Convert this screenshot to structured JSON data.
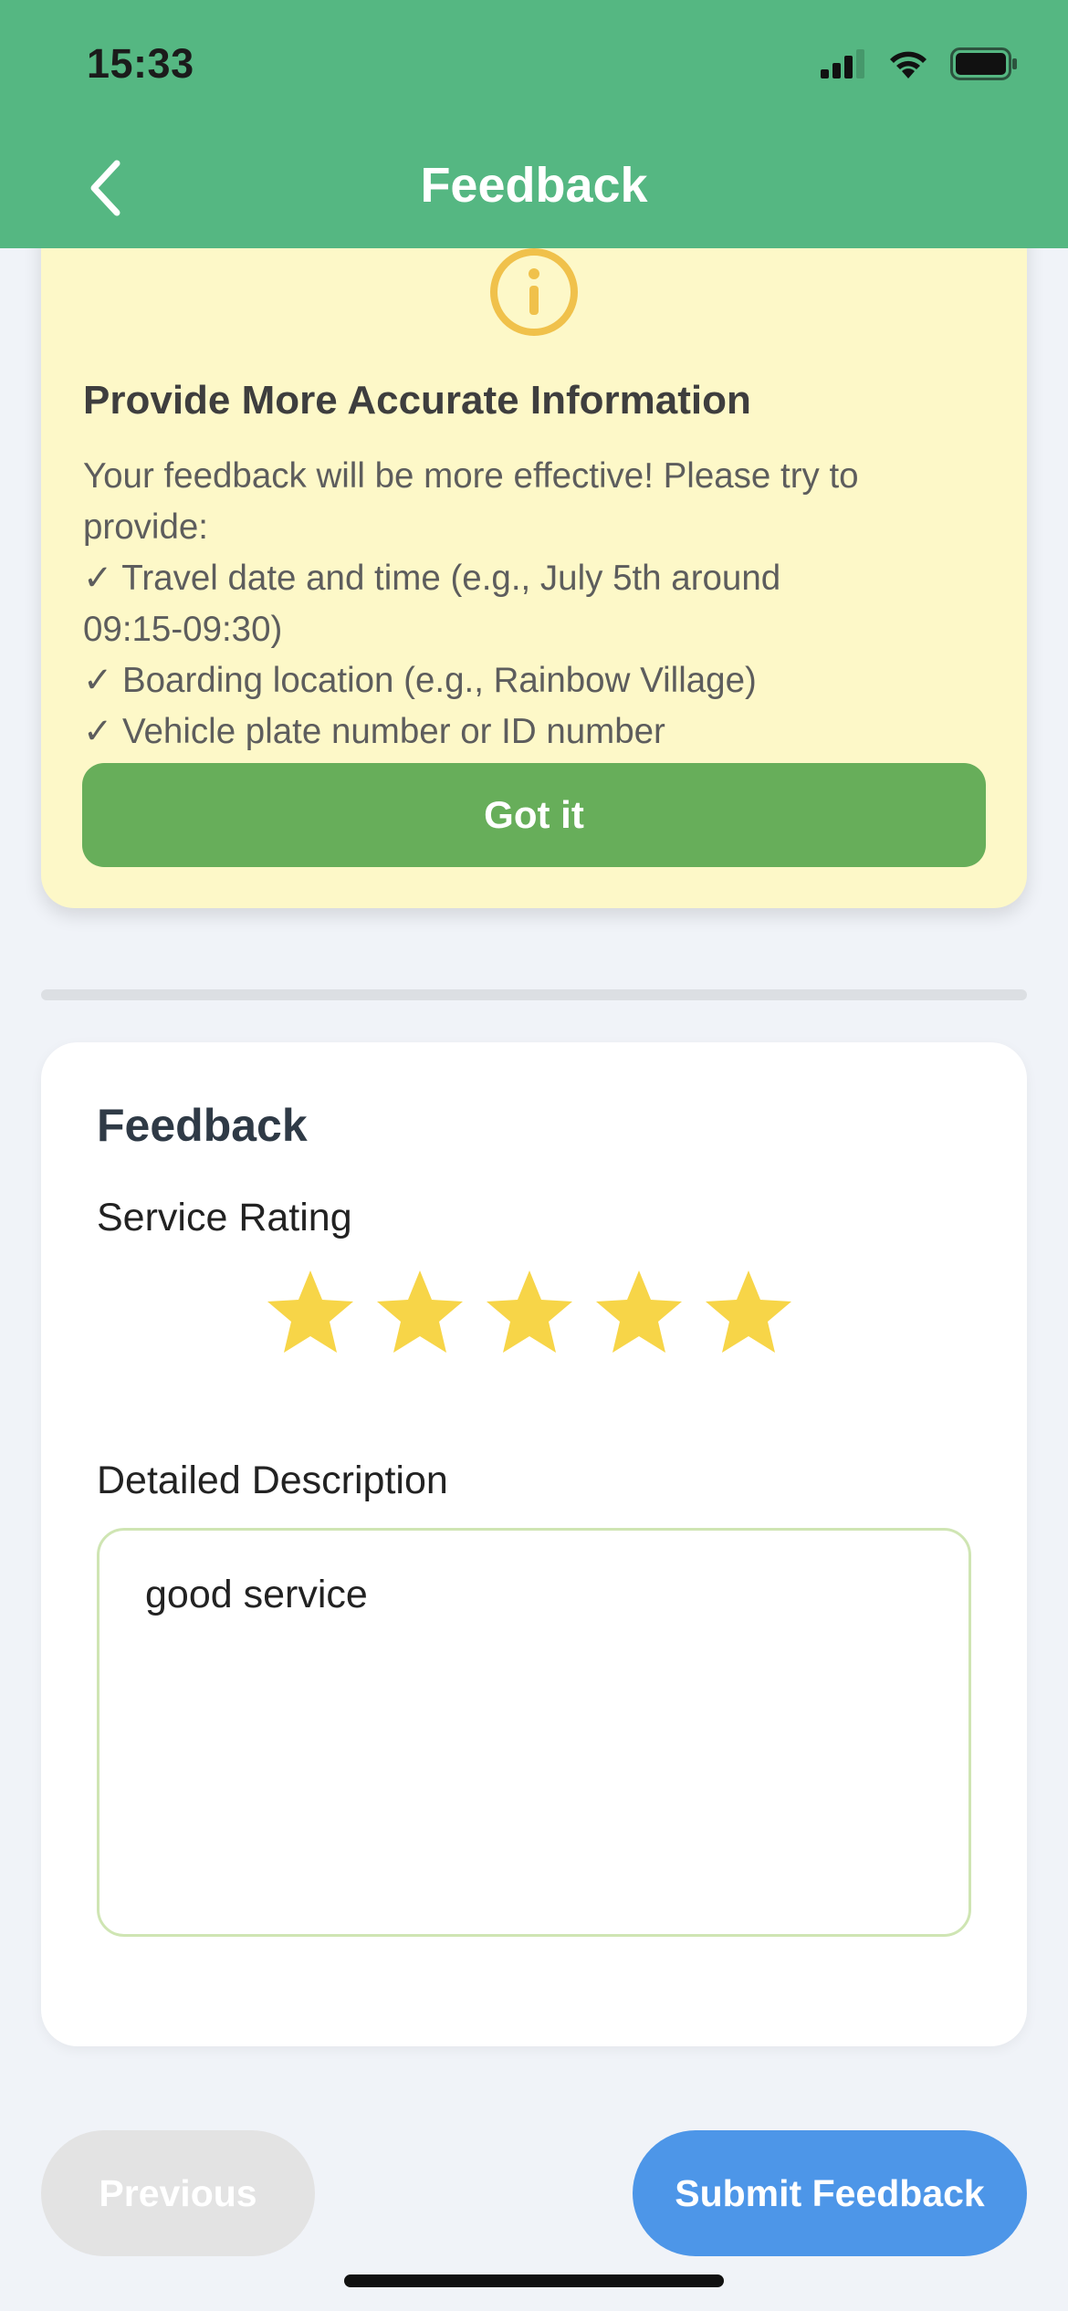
{
  "status_bar": {
    "time": "15:33",
    "icons": [
      "cellular-signal-icon",
      "wifi-icon",
      "battery-icon"
    ]
  },
  "nav": {
    "title": "Feedback",
    "back_icon": "chevron-left-icon"
  },
  "tip": {
    "icon": "info-circle-icon",
    "title": "Provide More Accurate Information",
    "lines": [
      "Your feedback will be more effective! Please try to",
      "provide:",
      "✓ Travel date and time (e.g., July 5th around",
      "09:15-09:30)",
      "✓ Boarding location (e.g., Rainbow Village)",
      "✓ Vehicle plate number or ID number"
    ],
    "button_label": "Got it"
  },
  "feedback": {
    "title": "Feedback",
    "rating_label": "Service Rating",
    "rating": 5,
    "rating_max": 5,
    "description_label": "Detailed Description",
    "description_value": "good service"
  },
  "actions": {
    "previous_label": "Previous",
    "submit_label": "Submit Feedback"
  },
  "colors": {
    "header": "#55b782",
    "tip_background": "#fdf8c8",
    "got_it": "#67ae5a",
    "star": "#f7d548",
    "submit": "#4d96e8",
    "previous": "#e3e3e3"
  }
}
